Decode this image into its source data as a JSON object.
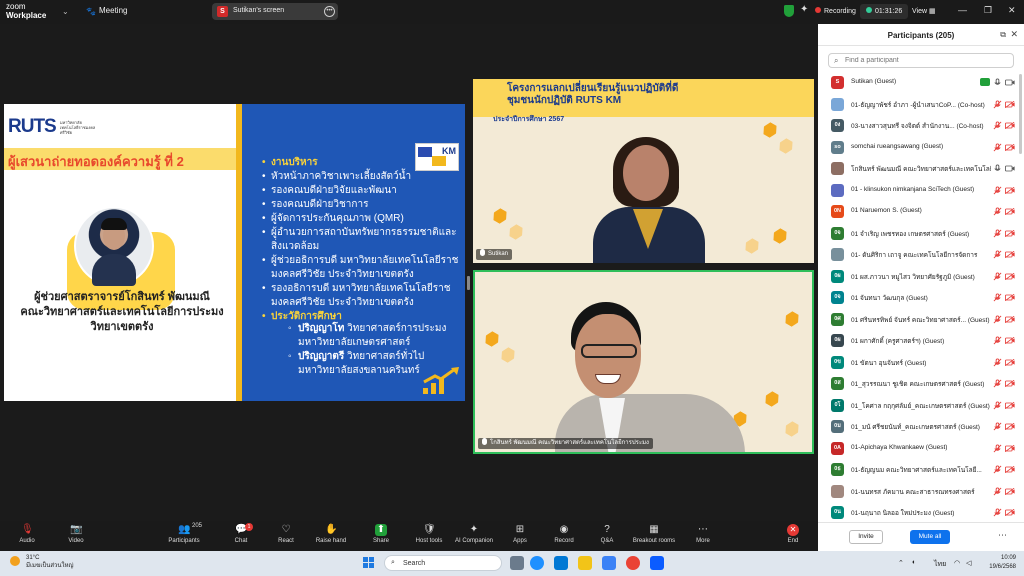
{
  "topbar": {
    "logo_line1": "zoom",
    "logo_line2": "Workplace",
    "meeting_label": "Meeting",
    "screen_label": "Sutikan's screen",
    "screen_initial": "S",
    "recording_label": "Recording",
    "timer": "01:31:26",
    "view_label": "View"
  },
  "slide": {
    "logo_text": "RUTS",
    "logo_sub": "มหาวิทยาลัยเทคโนโลยีราชมงคลศรีวิชัย",
    "km_text": "KM",
    "presenter_title": "ผู้เสวนาถ่ายทอดองค์ความรู้ ที่ 2",
    "presenter_name": [
      "ผู้ช่วยศาสตราจารย์โกสินทร์ พัฒนมณี",
      "คณะวิทยาศาสตร์และเทคโนโลยีการประมง",
      "วิทยาเขตตรัง"
    ],
    "items": [
      {
        "text": "งานบริหาร",
        "head": true
      },
      {
        "text": "หัวหน้าภาควิชาเพาะเลี้ยงสัตว์น้ำ",
        "head": false
      },
      {
        "text": "รองคณบดีฝ่ายวิจัยและพัฒนา",
        "head": false
      },
      {
        "text": "รองคณบดีฝ่ายวิชาการ",
        "head": false
      },
      {
        "text": "ผู้จัดการประกันคุณภาพ (QMR)",
        "head": false
      },
      {
        "text": "ผู้อำนวยการสถาบันทรัพยากรธรรมชาติและสิ่งแวดล้อม",
        "head": false
      },
      {
        "text": "ผู้ช่วยอธิการบดี มหาวิทยาลัยเทคโนโลยีราชมงคลศรีวิชัย ประจำวิทยาเขตตรัง",
        "head": false
      },
      {
        "text": "รองอธิการบดี มหาวิทยาลัยเทคโนโลยีราชมงคลศรีวิชัย ประจำวิทยาเขตตรัง",
        "head": false
      },
      {
        "text": "ประวัติการศึกษา",
        "head": true
      }
    ],
    "education": [
      {
        "degree": "ปริญญาโท",
        "detail": " วิทยาศาสตร์การประมง มหาวิทยาลัยเกษตรศาสตร์"
      },
      {
        "degree": "ปริญญาตรี",
        "detail": " วิทยาศาสตร์ทั่วไป มหาวิทยาลัยสงขลานครินทร์"
      }
    ]
  },
  "videos": {
    "banner_line1": "โครงการแลกเปลี่ยนเรียนรู้แนวปฏิบัติที่ดี",
    "banner_line2": "ชุมชนนักปฏิบัติ",
    "banner_km": "RUTS KM",
    "banner_year": "ประจำปีการศึกษา 2567",
    "v1_label": "Sutikan",
    "v2_label": "โกสินทร์ พัฒนมณี คณะวิทยาศาสตร์และเทคโนโลยีการประมง"
  },
  "panel": {
    "title": "Participants (205)",
    "search_placeholder": "Find a participant",
    "invite_label": "Invite",
    "mute_all_label": "Mute all",
    "participants": [
      {
        "initials": "S",
        "color": "#d32f2f",
        "name": "Sutikan (Guest)",
        "mic": "on",
        "cam": "on",
        "green": true
      },
      {
        "initials": "",
        "color": "#7aa7d8",
        "name": "01-ธัญญาพัชร์ อำภา -ผู้นำเสนาCoP... (Co-host)",
        "mic": "muted",
        "cam": "off",
        "green": false
      },
      {
        "initials": "0ง",
        "color": "#455a64",
        "name": "03-นางสาวสุนทรี จงจิตต์ สำนักงาน... (Co-host)",
        "mic": "muted",
        "cam": "off",
        "green": false
      },
      {
        "initials": "so",
        "color": "#607d8b",
        "name": "somchai rueangsawang (Guest)",
        "mic": "muted",
        "cam": "off",
        "green": false
      },
      {
        "initials": "",
        "color": "#8d6e63",
        "name": "โกสินทร์ พัฒนมณี คณะวิทยาศาสตร์และเทคโนโลยี...",
        "mic": "on",
        "cam": "on",
        "green": false
      },
      {
        "initials": "",
        "color": "#5c6bc0",
        "name": "01 - klinsukon nimkanjana  SciTech (Guest)",
        "mic": "muted",
        "cam": "off",
        "green": false
      },
      {
        "initials": "0N",
        "color": "#e64a19",
        "name": "01 Naruemon S. (Guest)",
        "mic": "muted",
        "cam": "off",
        "green": false
      },
      {
        "initials": "0จ",
        "color": "#2e7d32",
        "name": "01 จำเริญ  เพชรทอง เกษตรศาสตร์ (Guest)",
        "mic": "muted",
        "cam": "off",
        "green": false
      },
      {
        "initials": "",
        "color": "#78909c",
        "name": "01- ดันศิริกา เถาจู คณะเทคโนโลยีการจัดการ",
        "mic": "muted",
        "cam": "off",
        "green": false
      },
      {
        "initials": "0ผ",
        "color": "#00897b",
        "name": "01 ผส.ภาวนา หมูไสว วิทยาศัยรัฐภูมิ (Guest)",
        "mic": "muted",
        "cam": "off",
        "green": false
      },
      {
        "initials": "0จ",
        "color": "#00838f",
        "name": "01 จันทนา วัฒนกุล (Guest)",
        "mic": "muted",
        "cam": "off",
        "green": false
      },
      {
        "initials": "0ศ",
        "color": "#2e7d32",
        "name": "01 ศรินทรทิพย์ จันทร์ คณะวิทยาศาสตร์... (Guest)",
        "mic": "muted",
        "cam": "off",
        "green": false
      },
      {
        "initials": "0ผ",
        "color": "#37474f",
        "name": "01 ผกาศักดิ์ (ครูศาสตร์ฯ) (Guest)",
        "mic": "muted",
        "cam": "off",
        "green": false
      },
      {
        "initials": "0ข",
        "color": "#00897b",
        "name": "01  ขัตนา  อุนจันทร์ (Guest)",
        "mic": "muted",
        "cam": "off",
        "green": false
      },
      {
        "initials": "0ส",
        "color": "#2e7d32",
        "name": "01_สุวรรณนา ชูเชิด คณะเกษตรศาสตร์ (Guest)",
        "mic": "muted",
        "cam": "off",
        "green": false
      },
      {
        "initials": "0โ",
        "color": "#00796b",
        "name": "01_โคศาล กฤกุศลัมย์_คณะเกษตรศาสตร์ (Guest)",
        "mic": "muted",
        "cam": "off",
        "green": false
      },
      {
        "initials": "0ม",
        "color": "#546e7a",
        "name": "01_มนั ศรีชยนันท์_คณะเกษตรศาสตร์ (Guest)",
        "mic": "muted",
        "cam": "off",
        "green": false
      },
      {
        "initials": "0A",
        "color": "#c62828",
        "name": "01-Apichaya Khwankaew (Guest)",
        "mic": "muted",
        "cam": "off",
        "green": false
      },
      {
        "initials": "0ธ",
        "color": "#2e7d32",
        "name": "01-ธัญญนม คณะวิทยาศาสตร์และเทคโนโลยี...",
        "mic": "muted",
        "cam": "off",
        "green": false
      },
      {
        "initials": "",
        "color": "#a1887f",
        "name": "01-นนทรส ภัคมาน คณะสาธารณทรงศาสตร์",
        "mic": "muted",
        "cam": "off",
        "green": false
      },
      {
        "initials": "0น",
        "color": "#00897b",
        "name": "01-นฤนาถ นิลออ ใหม่ประมง (Guest)",
        "mic": "muted",
        "cam": "off",
        "green": false
      }
    ]
  },
  "toolbar": {
    "items": [
      {
        "key": "audio",
        "label": "Audio",
        "icon": "🎙"
      },
      {
        "key": "video",
        "label": "Video",
        "icon": "📷"
      },
      {
        "key": "participants",
        "label": "Participants",
        "icon": "👥",
        "count": "205"
      },
      {
        "key": "chat",
        "label": "Chat",
        "icon": "💬",
        "badge": "1"
      },
      {
        "key": "react",
        "label": "React",
        "icon": "♡"
      },
      {
        "key": "raise-hand",
        "label": "Raise hand",
        "icon": "✋"
      },
      {
        "key": "share",
        "label": "Share",
        "icon": "⬆"
      },
      {
        "key": "host-tools",
        "label": "Host tools",
        "icon": "🛡"
      },
      {
        "key": "ai-companion",
        "label": "AI Companion",
        "icon": "✦"
      },
      {
        "key": "apps",
        "label": "Apps",
        "icon": "⊞"
      },
      {
        "key": "record",
        "label": "Record",
        "icon": "◉"
      },
      {
        "key": "qa",
        "label": "Q&A",
        "icon": "?"
      },
      {
        "key": "breakout",
        "label": "Breakout rooms",
        "icon": "▦"
      },
      {
        "key": "more",
        "label": "More",
        "icon": "⋯"
      },
      {
        "key": "end",
        "label": "End",
        "icon": "✕"
      }
    ]
  },
  "taskbar": {
    "temp": "31°C",
    "weather": "มีเมฆเป็นส่วนใหญ่",
    "search": "Search",
    "lang": "ไทย",
    "time": "10:09",
    "date": "19/6/2568"
  },
  "colors": {
    "accent": "#0e72ed",
    "slide_blue": "#1f57b6",
    "slide_gold": "#f2b81d",
    "active_speaker": "#2fbe5a"
  }
}
